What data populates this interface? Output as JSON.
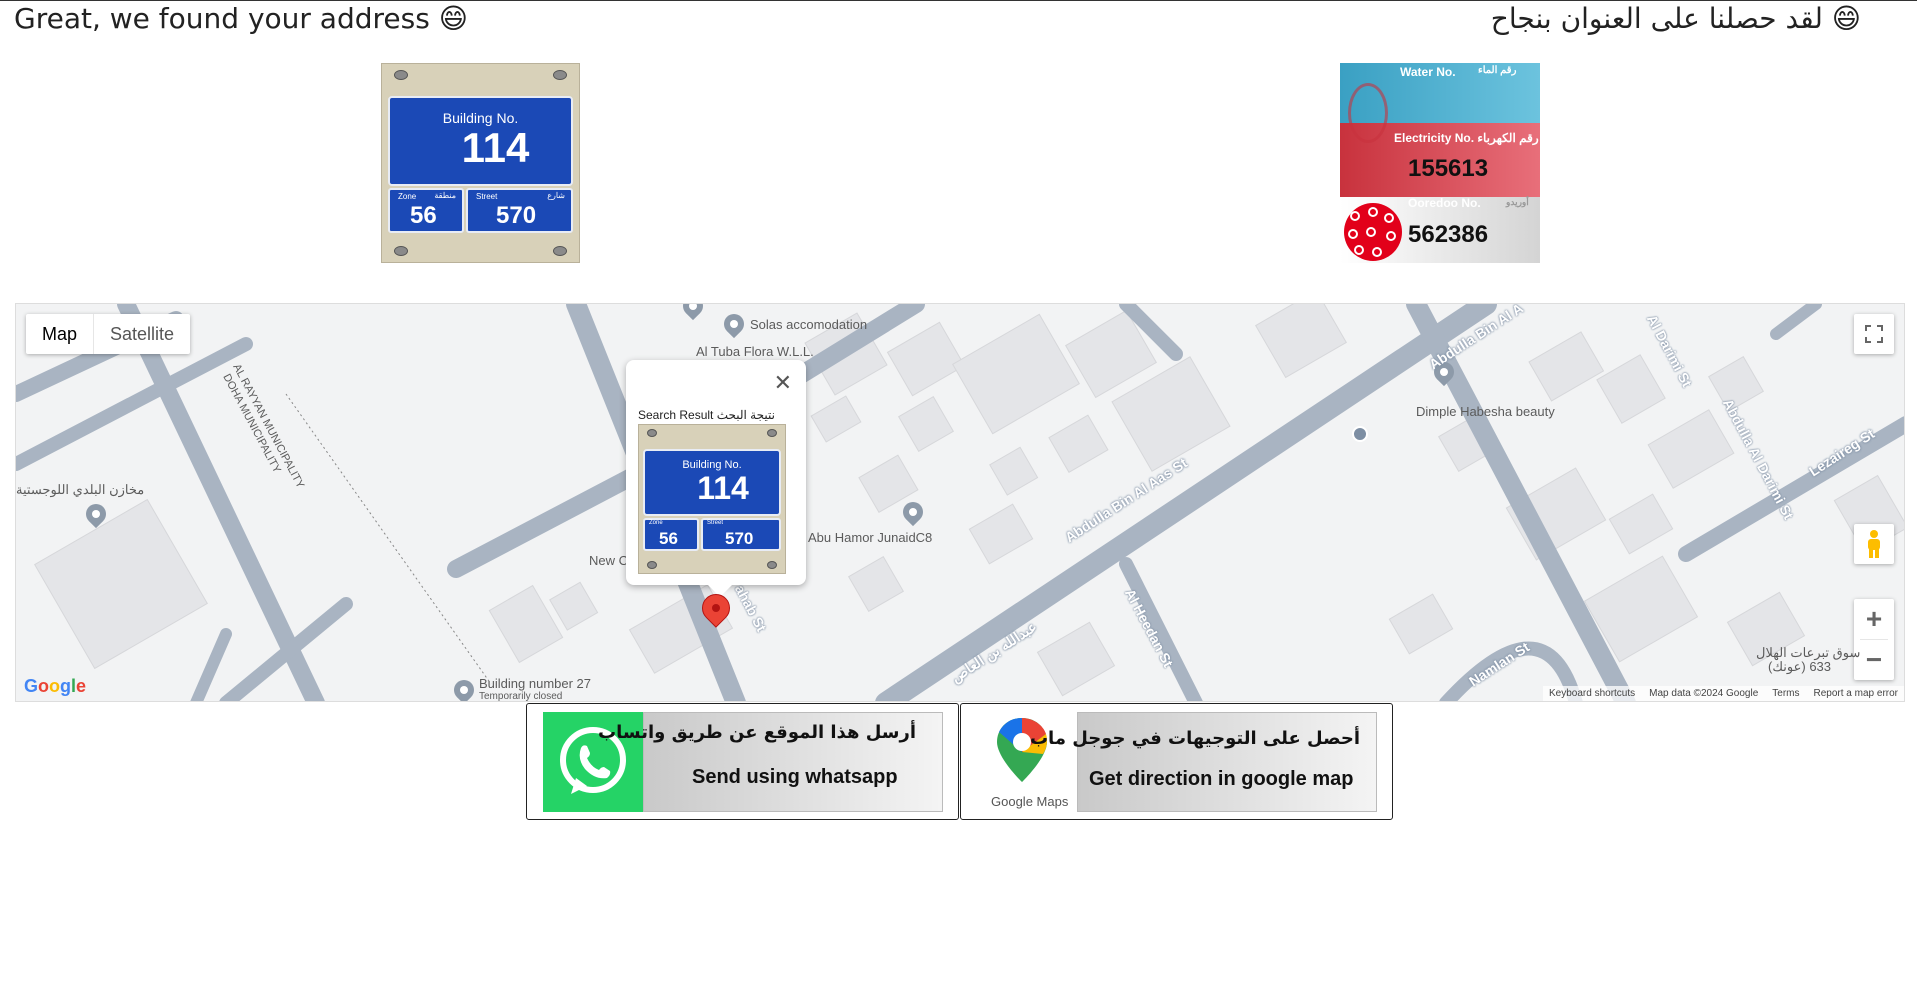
{
  "header": {
    "title_en": "Great, we found your address 😄",
    "title_ar": "😄 لقد حصلنا على العنوان بنجاح"
  },
  "plate": {
    "label": "Building No.",
    "building_no": "114",
    "zone_label_en": "Zone",
    "zone_label_ar": "منطقة",
    "zone_no": "56",
    "street_label_en": "Street",
    "street_label_ar": "شارع",
    "street_no": "570"
  },
  "utility": {
    "water_en": "Water No.",
    "water_ar": "رقم الماء",
    "electricity_label": "Electricity No. رقم الكهرباء",
    "electricity_no": "155613",
    "ooredoo_en": "Ooredoo No.",
    "ooredoo_ar": "أوريدو",
    "ooredoo_no": "562386"
  },
  "map": {
    "type_map": "Map",
    "type_satellite": "Satellite",
    "places": {
      "solas": "Solas accomodation",
      "tuba": "Al Tuba Flora W.L.L.",
      "dimple": "Dimple Habesha beauty",
      "abu_hamor": "Abu Hamor JunaidC8",
      "new_c": "New C",
      "building27": "Building number 27",
      "temp_closed": "Temporarily closed",
      "municipal_ar": "مخازن البلدي اللوجستية",
      "rayyan": "AL RAYYAN MUNICIPALITY",
      "doha": "DOHA MUNICIPALITY",
      "hilal_ar": "سوق تبرعات الهلال",
      "hilal_no": "633 (عونك)"
    },
    "roads": {
      "abdulla_bin_al_aas": "Abdulla Bin Al Aas St",
      "abdulla_ar": "عبدالله بن العاص",
      "abdulla_bin_top": "Abdulla Bin Al A",
      "al_darimi_1": "Al Darimi St",
      "al_darimi_2": "Abdulla Al Darimi St",
      "lezaireg": "Lezaireg St",
      "al_heedan": "Al Heedan St",
      "namlan": "Namlan St",
      "sahab": "ahab St"
    },
    "info_window": {
      "title": "Search Result نتيجة البحث",
      "close": "✕"
    },
    "footer": {
      "shortcuts": "Keyboard shortcuts",
      "data": "Map data ©2024 Google",
      "terms": "Terms",
      "report": "Report a map error"
    },
    "google": "Google",
    "zoom_in": "+",
    "zoom_out": "−"
  },
  "actions": {
    "whatsapp_ar": "أرسل هذا الموقع عن طريق واتساب",
    "whatsapp_en": "Send using whatsapp",
    "gmaps_ar": "أحصل على التوجيهات في جوجل ماب",
    "gmaps_en": "Get direction in google map",
    "gmaps_logo": "Google Maps"
  }
}
